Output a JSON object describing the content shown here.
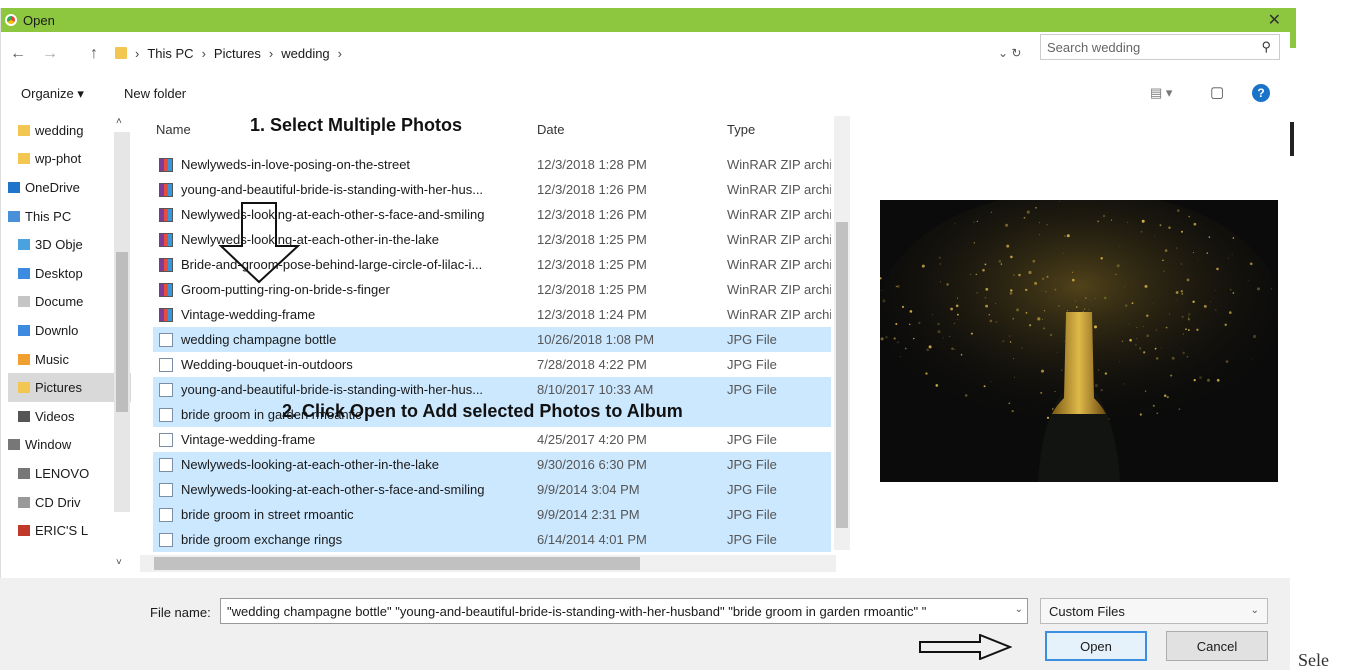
{
  "window": {
    "title": "Open",
    "close_glyph": "✕"
  },
  "address": {
    "back": "←",
    "forward": "→",
    "up": "↑",
    "crumbs": [
      "This PC",
      "Pictures",
      "wedding"
    ],
    "separator": "›",
    "dropdown_refresh": "⌄ ↻",
    "search_placeholder": "Search wedding"
  },
  "toolbar": {
    "organize": "Organize ▾",
    "new_folder": "New folder",
    "view_glyph": "▤ ▾",
    "pane_glyph": "▢",
    "help": "?"
  },
  "nav_items": [
    {
      "label": "wedding",
      "icon": "folder-icon",
      "color": "#f3c651"
    },
    {
      "label": "wp-phot",
      "icon": "folder-icon",
      "color": "#f3c651"
    },
    {
      "label": "OneDrive",
      "icon": "cloud-icon",
      "color": "#1e74c8"
    },
    {
      "label": "This PC",
      "icon": "computer-icon",
      "color": "#4a90d9"
    },
    {
      "label": "3D Obje",
      "icon": "folder-3d-icon",
      "color": "#4aa3df"
    },
    {
      "label": "Desktop",
      "icon": "desktop-folder-icon",
      "color": "#3d8be0"
    },
    {
      "label": "Docume",
      "icon": "documents-folder-icon",
      "color": "#c5c5c5"
    },
    {
      "label": "Downlo",
      "icon": "downloads-folder-icon",
      "color": "#3d8be0"
    },
    {
      "label": "Music",
      "icon": "music-folder-icon",
      "color": "#f0a030"
    },
    {
      "label": "Pictures",
      "icon": "pictures-folder-icon",
      "color": "#f3c651",
      "selected": true
    },
    {
      "label": "Videos",
      "icon": "videos-folder-icon",
      "color": "#555555"
    },
    {
      "label": "Window",
      "icon": "drive-icon",
      "color": "#777777"
    },
    {
      "label": "LENOVO",
      "icon": "drive-icon",
      "color": "#777777"
    },
    {
      "label": "CD Driv",
      "icon": "cd-drive-icon",
      "color": "#999999"
    },
    {
      "label": "ERIC'S L",
      "icon": "sd-card-icon",
      "color": "#c0392b"
    }
  ],
  "columns": {
    "name": "Name",
    "date": "Date",
    "type": "Type"
  },
  "files": [
    {
      "name": "Newlyweds-in-love-posing-on-the-street",
      "date": "12/3/2018 1:28 PM",
      "type": "WinRAR ZIP archive",
      "kind": "zip",
      "selected": false
    },
    {
      "name": "young-and-beautiful-bride-is-standing-with-her-hus...",
      "date": "12/3/2018 1:26 PM",
      "type": "WinRAR ZIP archive",
      "kind": "zip",
      "selected": false
    },
    {
      "name": "Newlyweds-looking-at-each-other-s-face-and-smiling",
      "date": "12/3/2018 1:26 PM",
      "type": "WinRAR ZIP archive",
      "kind": "zip",
      "selected": false
    },
    {
      "name": "Newlyweds-looking-at-each-other-in-the-lake",
      "date": "12/3/2018 1:25 PM",
      "type": "WinRAR ZIP archive",
      "kind": "zip",
      "selected": false
    },
    {
      "name": "Bride-and-groom-pose-behind-large-circle-of-lilac-i...",
      "date": "12/3/2018 1:25 PM",
      "type": "WinRAR ZIP archive",
      "kind": "zip",
      "selected": false
    },
    {
      "name": "Groom-putting-ring-on-bride-s-finger",
      "date": "12/3/2018 1:25 PM",
      "type": "WinRAR ZIP archive",
      "kind": "zip",
      "selected": false
    },
    {
      "name": "Vintage-wedding-frame",
      "date": "12/3/2018 1:24 PM",
      "type": "WinRAR ZIP archive",
      "kind": "zip",
      "selected": false
    },
    {
      "name": "wedding champagne bottle",
      "date": "10/26/2018 1:08 PM",
      "type": "JPG File",
      "kind": "jpg",
      "selected": true
    },
    {
      "name": "Wedding-bouquet-in-outdoors",
      "date": "7/28/2018 4:22 PM",
      "type": "JPG File",
      "kind": "jpg",
      "selected": false
    },
    {
      "name": "young-and-beautiful-bride-is-standing-with-her-hus...",
      "date": "8/10/2017 10:33 AM",
      "type": "JPG File",
      "kind": "jpg",
      "selected": true
    },
    {
      "name": "bride groom in garden rmoantic",
      "date": "",
      "type": "",
      "kind": "jpg",
      "selected": true
    },
    {
      "name": "Vintage-wedding-frame",
      "date": "4/25/2017 4:20 PM",
      "type": "JPG File",
      "kind": "jpg",
      "selected": false
    },
    {
      "name": "Newlyweds-looking-at-each-other-in-the-lake",
      "date": "9/30/2016 6:30 PM",
      "type": "JPG File",
      "kind": "jpg",
      "selected": true
    },
    {
      "name": "Newlyweds-looking-at-each-other-s-face-and-smiling",
      "date": "9/9/2014 3:04 PM",
      "type": "JPG File",
      "kind": "jpg",
      "selected": true
    },
    {
      "name": "bride groom in street rmoantic",
      "date": "9/9/2014 2:31 PM",
      "type": "JPG File",
      "kind": "jpg",
      "selected": true
    },
    {
      "name": "bride groom exchange rings",
      "date": "6/14/2014 4:01 PM",
      "type": "JPG File",
      "kind": "jpg",
      "selected": true
    }
  ],
  "annotations": {
    "step1": "1. Select Multiple Photos",
    "step2": "2. Click Open to Add selected Photos to Album"
  },
  "footer": {
    "file_name_label": "File name:",
    "file_name_value": "\"wedding champagne bottle\" \"young-and-beautiful-bride-is-standing-with-her-husband\" \"bride groom in garden rmoantic\" \"",
    "filter": "Custom Files",
    "open": "Open",
    "cancel": "Cancel"
  },
  "trailing_text": "Sele",
  "colors": {
    "titlebar": "#8dc63f",
    "selection": "#cce8ff",
    "primary_border": "#3c8fe0"
  }
}
